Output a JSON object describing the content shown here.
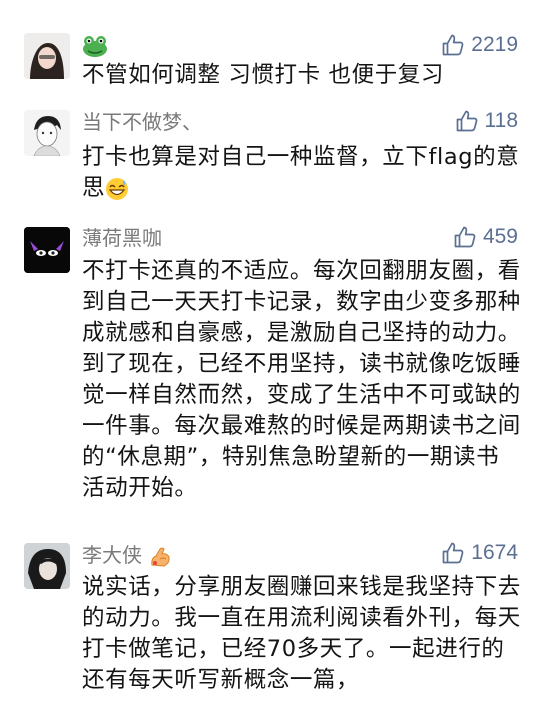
{
  "colors": {
    "like_blue": "#5b6f93",
    "nickname_gray": "#7a7a7a",
    "text": "#141414"
  },
  "comments": [
    {
      "nickname": "",
      "nickname_emoji": "frog-emoji",
      "likes": "2219",
      "text": "不管如何调整 习惯打卡 也便于复习"
    },
    {
      "nickname": "当下不做梦、",
      "likes": "118",
      "text_before_emoji": "打卡也算是对自己一种监督，立下flag的意思",
      "trailing_emoji": "grinning-sweat-emoji"
    },
    {
      "nickname": "薄荷黑咖",
      "likes": "459",
      "text": "不打卡还真的不适应。每次回翻朋友圈，看到自己一天天打卡记录，数字由少变多那种成就感和自豪感，是激励自己坚持的动力。到了现在，已经不用坚持，读书就像吃饭睡觉一样自然而然，变成了生活中不可或缺的一件事。每次最难熬的时候是两期读书之间的“休息期”，特别焦急盼望新的一期读书活动开始。"
    },
    {
      "nickname": "李大侠",
      "nickname_emoji": "flexed-arm-emoji",
      "likes": "1674",
      "text": "说实话，分享朋友圈赚回来钱是我坚持下去的动力。我一直在用流利阅读看外刊，每天打卡做笔记，已经70多天了。一起进行的还有每天听写新概念一篇，"
    }
  ]
}
